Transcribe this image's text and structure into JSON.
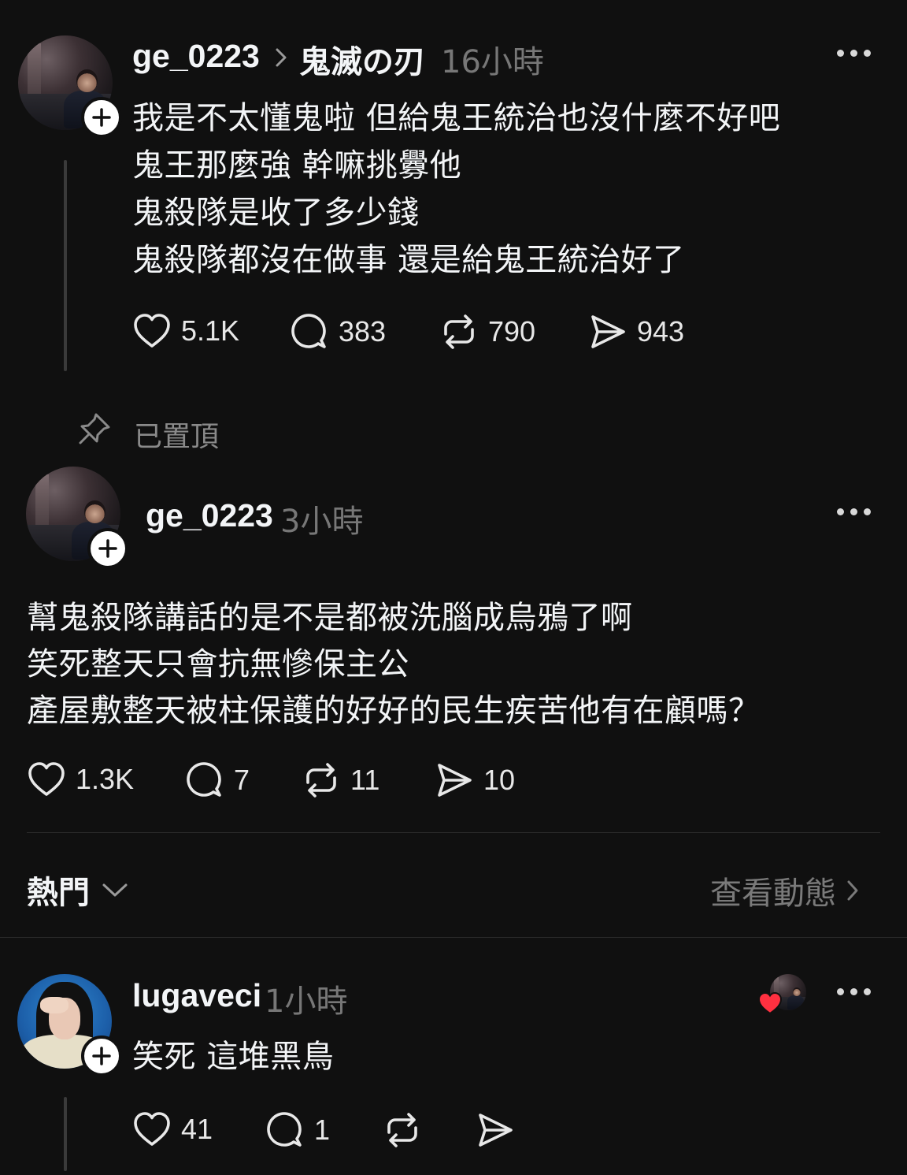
{
  "posts": [
    {
      "username": "ge_0223",
      "topic": "鬼滅の刃",
      "time": "16小時",
      "lines": [
        "我是不太懂鬼啦 但給鬼王統治也沒什麼不好吧",
        "鬼王那麼強 幹嘛挑釁他",
        "鬼殺隊是收了多少錢",
        "鬼殺隊都沒在做事 還是給鬼王統治好了"
      ],
      "likes": "5.1K",
      "replies": "383",
      "reposts": "790",
      "shares": "943"
    },
    {
      "pinned_label": "已置頂",
      "username": "ge_0223",
      "time": "3小時",
      "lines": [
        "幫鬼殺隊講話的是不是都被洗腦成烏鴉了啊",
        "笑死整天只會抗無慘保主公",
        "產屋敷整天被柱保護的好好的民生疾苦他有在顧嗎？"
      ],
      "likes": "1.3K",
      "replies": "7",
      "reposts": "11",
      "shares": "10"
    },
    {
      "username": "lugaveci",
      "time": "1小時",
      "lines": [
        "笑死 這堆黑鳥"
      ],
      "likes": "41",
      "replies": "1"
    }
  ],
  "sort_bar": {
    "label": "熱門",
    "activity_link": "查看動態"
  },
  "colors": {
    "background": "#101010",
    "text": "#f3f5f7",
    "muted": "#777777",
    "heart": "#ff3040"
  },
  "icons": [
    "heart-icon",
    "comment-icon",
    "repost-icon",
    "share-icon",
    "pin-icon",
    "chevron-down-icon",
    "chevron-right-icon",
    "plus-icon",
    "more-icon"
  ]
}
